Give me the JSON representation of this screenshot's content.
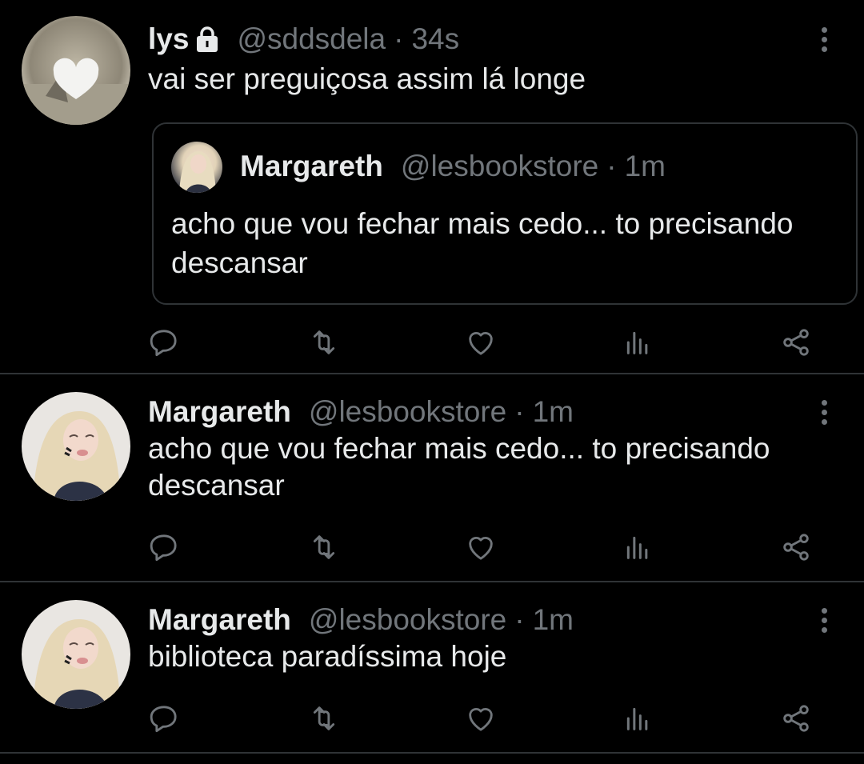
{
  "tweets": [
    {
      "name": "lys",
      "handle": "@sddsdela",
      "separator": "·",
      "time": "34s",
      "text": "vai ser preguiçosa assim lá longe",
      "protected": true,
      "quote": {
        "name": "Margareth",
        "handle": "@lesbookstore",
        "separator": "·",
        "time": "1m",
        "text": "acho que vou fechar mais cedo... to precisando descansar"
      }
    },
    {
      "name": "Margareth",
      "handle": "@lesbookstore",
      "separator": "·",
      "time": "1m",
      "text": "acho que vou fechar mais cedo... to precisando descansar"
    },
    {
      "name": "Margareth",
      "handle": "@lesbookstore",
      "separator": "·",
      "time": "1m",
      "text": "biblioteca paradíssima hoje"
    }
  ],
  "icons": {
    "reply": "reply-icon",
    "retweet": "retweet-icon",
    "like": "heart-icon",
    "views": "analytics-icon",
    "share": "share-icon",
    "more": "more-vertical-icon",
    "lock": "lock-icon"
  },
  "colors": {
    "background": "#000000",
    "text": "#e7e9ea",
    "muted": "#71767b",
    "border": "#2f3336"
  }
}
